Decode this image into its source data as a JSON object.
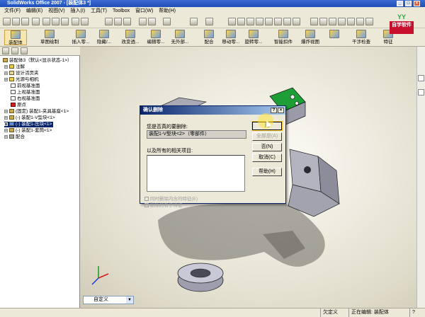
{
  "window": {
    "title": "SolidWorks Office 2007 - [装配体3 *]",
    "menu": [
      "文件(F)",
      "编辑(E)",
      "视图(V)",
      "插入(I)",
      "工具(T)",
      "Toolbox",
      "窗口(W)",
      "帮助(H)"
    ]
  },
  "command_bar": {
    "items": [
      "装配体",
      "草图绘制",
      "插入零...",
      "隐藏/...",
      "改变透...",
      "编辑零...",
      "无外部...",
      "配合",
      "移动零...",
      "旋转零...",
      "智能扣件",
      "爆炸视图",
      "",
      "干涉检查",
      "特征"
    ]
  },
  "logo_text": "自学软件",
  "feature_tree": {
    "root": "装配体3（默认<显示状态-1>）",
    "items": [
      "注解",
      "设计活页夹",
      "光源与相机",
      "前视基准面",
      "上视基准面",
      "右视基准面",
      "原点",
      "(固定) 装配1-夹具基座<1>",
      "(-) 装配1-V型块<1>",
      "(-) 装配1-压块<1>",
      "(-) 装配1-套筒<1>",
      "配合"
    ]
  },
  "dialog": {
    "title": "确认删除",
    "question": "您是否真的要删除:",
    "item_value": "装配1-V型块<2>（零部件）",
    "related_label": "以及所有的相关项目:",
    "buttons": {
      "yes": "是",
      "yes_all": "全部是(A)",
      "no": "否(N)",
      "cancel": "取消(C)",
      "help": "帮助(H)"
    },
    "check1": "同时删除内含的特征(E)",
    "check2": "删除的有子特征"
  },
  "graphics": {
    "display_mode": "自定义"
  },
  "status": {
    "s1": "欠定义",
    "s2": "正在编辑: 装配体",
    "s3": "?"
  }
}
